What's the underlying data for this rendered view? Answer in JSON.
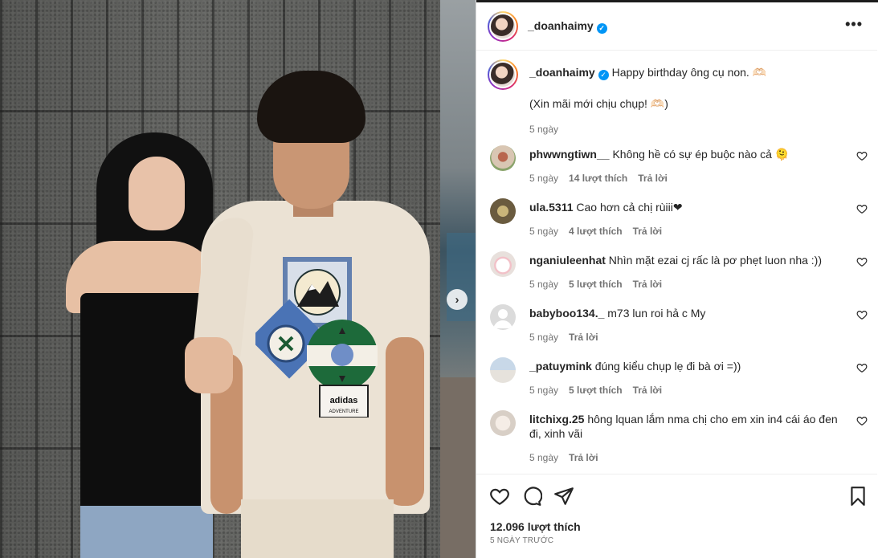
{
  "post": {
    "username": "_doanhaimy",
    "more_label": "•••",
    "caption": {
      "username": "_doanhaimy",
      "text": "Happy birthday ông cụ non. 🫶🏻",
      "line2": "(Xin mãi mới chịu chụp! 🫶🏻)",
      "time": "5 ngày"
    },
    "comments": [
      {
        "username": "phwwngtiwn__",
        "text": "Không hề có sự ép buộc nào cả 🫠",
        "time": "5 ngày",
        "likes": "14 lượt thích",
        "reply": "Trả lời"
      },
      {
        "username": "ula.5311",
        "text": "Cao hơn cả chị rùiii❤",
        "time": "5 ngày",
        "likes": "4 lượt thích",
        "reply": "Trả lời"
      },
      {
        "username": "nganiuleenhat",
        "text": "Nhìn mặt ezai cj rấc là pơ phẹt luon nha :))",
        "time": "5 ngày",
        "likes": "5 lượt thích",
        "reply": "Trả lời"
      },
      {
        "username": "babyboo134._",
        "text": "m73 lun roi hả c My",
        "time": "5 ngày",
        "likes": "",
        "reply": "Trả lời"
      },
      {
        "username": "_patuymink",
        "text": "đúng kiểu chụp lẹ đi bà ơi =))",
        "time": "5 ngày",
        "likes": "5 lượt thích",
        "reply": "Trả lời"
      },
      {
        "username": "litchixg.25",
        "text": "hông lquan lắm nma chị cho em xin in4 cái áo đen đi, xinh vãi",
        "time": "5 ngày",
        "likes": "",
        "reply": "Trả lời"
      }
    ],
    "likes_count": "12.096 lượt thích",
    "date": "5 NGÀY TRƯỚC",
    "shirt_brand": "adidas",
    "shirt_sub": "ADVENTURE"
  },
  "colors": {
    "verified": "#0095f6",
    "text": "#262626",
    "meta": "#737373"
  }
}
